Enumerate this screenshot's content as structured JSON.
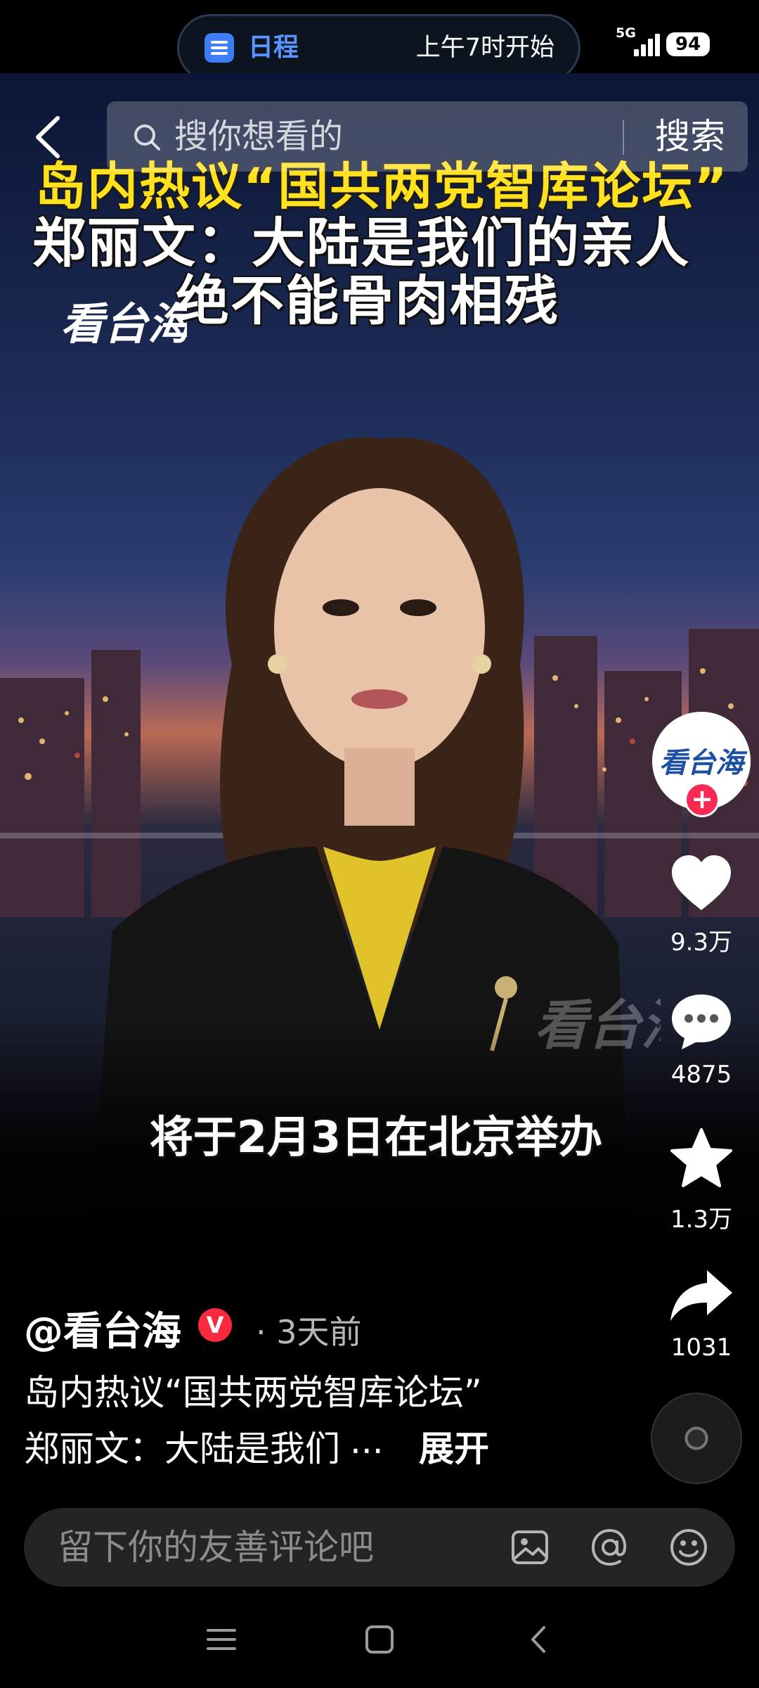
{
  "status_bar": {
    "schedule_label": "日程",
    "schedule_time": "上午7时开始",
    "network_type": "5G",
    "battery_level": "94"
  },
  "search": {
    "placeholder": "搜你想看的",
    "button_label": "搜索"
  },
  "video": {
    "headline_line1": "岛内热议“国共两党智库论坛”",
    "headline_line2": "郑丽文：大陆是我们的亲人",
    "headline_line3": "绝不能骨肉相残",
    "watermark": "看台海",
    "subtitle": "将于2月3日在北京举办"
  },
  "actions": {
    "likes": "9.3万",
    "comments": "4875",
    "favorites": "1.3万",
    "shares": "1031",
    "follow_symbol": "+"
  },
  "post": {
    "author": "@看台海",
    "verified_mark": "V",
    "time": "· 3天前",
    "caption_line1": "岛内热议“国共两党智库论坛”",
    "caption_line2": "郑丽文：大陆是我们",
    "ellipsis": "...",
    "expand_label": "展开"
  },
  "comment_bar": {
    "placeholder": "留下你的友善评论吧"
  },
  "colors": {
    "accent_red": "#fa2a55",
    "headline_yellow": "#ffe11f",
    "schedule_blue": "#3d7df5"
  },
  "icons": {
    "back": "chevron-left-icon",
    "search": "search-icon",
    "like": "heart-icon",
    "comment": "comment-bubble-icon",
    "favorite": "star-icon",
    "share": "share-arrow-icon",
    "image": "image-icon",
    "mention": "at-icon",
    "emoji": "smile-icon",
    "nav_menu": "menu-icon",
    "nav_home": "square-home-icon",
    "nav_back": "back-icon"
  }
}
